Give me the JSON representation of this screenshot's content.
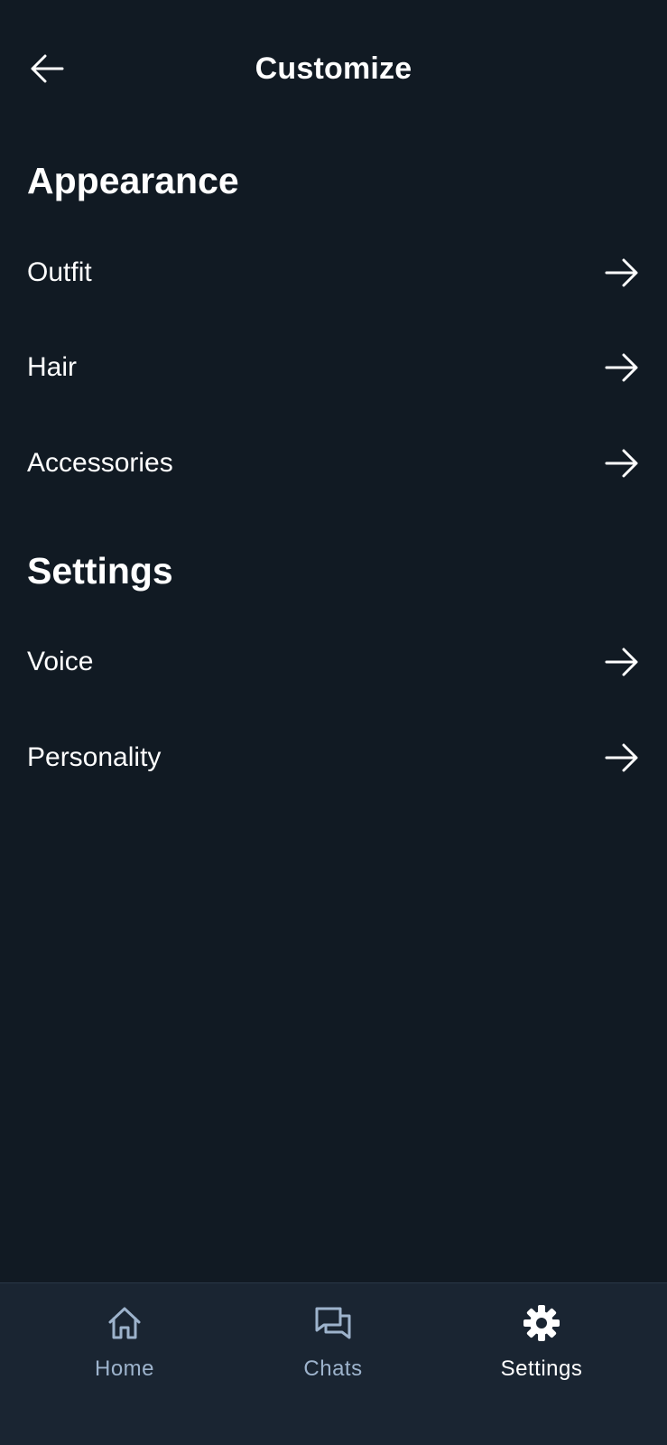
{
  "header": {
    "title": "Customize",
    "back_icon": "arrow-left-icon"
  },
  "sections": [
    {
      "title": "Appearance",
      "items": [
        {
          "label": "Outfit",
          "icon": "arrow-right-icon"
        },
        {
          "label": "Hair",
          "icon": "arrow-right-icon"
        },
        {
          "label": "Accessories",
          "icon": "arrow-right-icon"
        }
      ]
    },
    {
      "title": "Settings",
      "items": [
        {
          "label": "Voice",
          "icon": "arrow-right-icon"
        },
        {
          "label": "Personality",
          "icon": "arrow-right-icon"
        }
      ]
    }
  ],
  "bottom_nav": {
    "items": [
      {
        "label": "Home",
        "icon": "home-icon",
        "active": false
      },
      {
        "label": "Chats",
        "icon": "chat-bubbles-icon",
        "active": false
      },
      {
        "label": "Settings",
        "icon": "gear-icon",
        "active": true
      }
    ]
  },
  "colors": {
    "background": "#111a23",
    "nav_background": "#1a2532",
    "text": "#ffffff",
    "inactive_nav": "#9db3cc"
  }
}
